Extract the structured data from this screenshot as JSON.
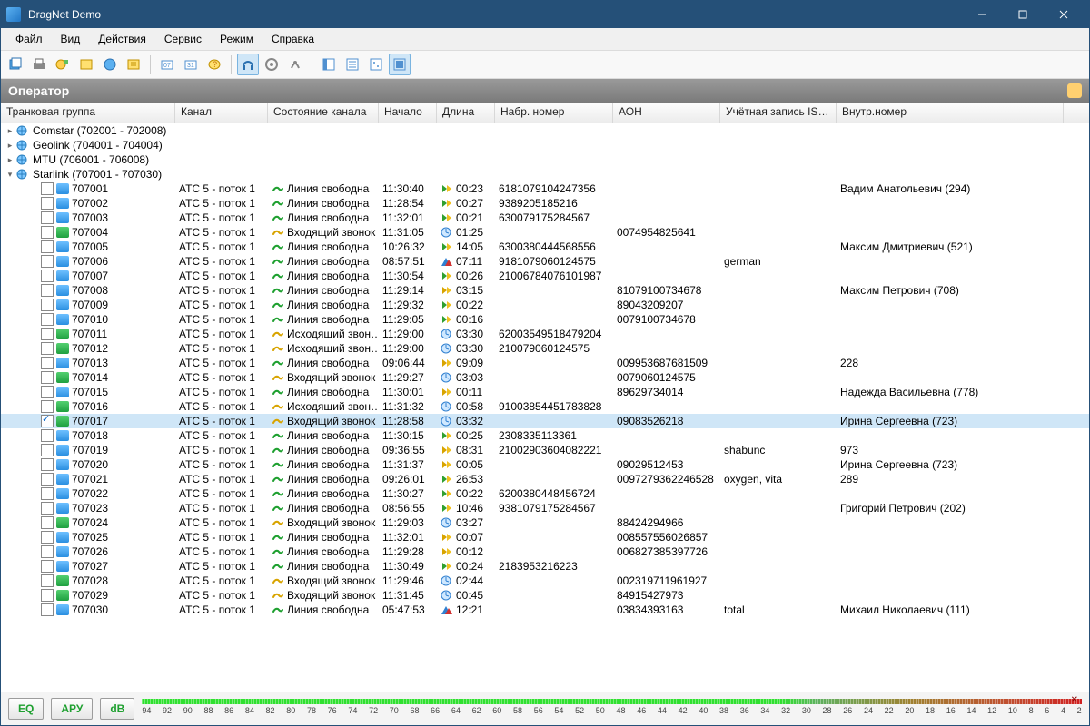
{
  "window": {
    "title": "DragNet Demo"
  },
  "menu": [
    "Файл",
    "Вид",
    "Действия",
    "Сервис",
    "Режим",
    "Справка"
  ],
  "section": {
    "title": "Оператор"
  },
  "columns": {
    "trunk": "Транковая группа",
    "channel": "Канал",
    "state": "Состояние канала",
    "start": "Начало",
    "length": "Длина",
    "dialed": "Набр. номер",
    "aon": "АОН",
    "isdn": "Учётная запись ISDN",
    "ext": "Внутр.номер"
  },
  "trunk_groups": [
    {
      "label": "Comstar (702001 - 702008)",
      "expanded": false
    },
    {
      "label": "Geolink (704001 - 704004)",
      "expanded": false
    },
    {
      "label": "MTU (706001 - 706008)",
      "expanded": false
    },
    {
      "label": "Starlink (707001 - 707030)",
      "expanded": true
    }
  ],
  "rows": [
    {
      "id": "707001",
      "chan": "АТС 5 - поток 1",
      "state": "Линия свободна",
      "si": "free",
      "start": "11:30:40",
      "len": "00:23",
      "li": "play",
      "dialed": "61810791042473­56",
      "aon": "",
      "isdn": "",
      "ext": "Вадим Анатольевич (294)",
      "sel": false,
      "chk": false,
      "ni": "a"
    },
    {
      "id": "707002",
      "chan": "АТС 5 - поток 1",
      "state": "Линия свободна",
      "si": "free",
      "start": "11:28:54",
      "len": "00:27",
      "li": "play",
      "dialed": "9389205185216",
      "aon": "",
      "isdn": "",
      "ext": "",
      "sel": false,
      "chk": false,
      "ni": "a"
    },
    {
      "id": "707003",
      "chan": "АТС 5 - поток 1",
      "state": "Линия свободна",
      "si": "free",
      "start": "11:32:01",
      "len": "00:21",
      "li": "play",
      "dialed": "630079175284567",
      "aon": "",
      "isdn": "",
      "ext": "",
      "sel": false,
      "chk": false,
      "ni": "a"
    },
    {
      "id": "707004",
      "chan": "АТС 5 - поток 1",
      "state": "Входящий звонок",
      "si": "in",
      "start": "11:31:05",
      "len": "01:25",
      "li": "clock",
      "dialed": "",
      "aon": "0074954825641",
      "isdn": "",
      "ext": "",
      "sel": false,
      "chk": false,
      "ni": "b"
    },
    {
      "id": "707005",
      "chan": "АТС 5 - поток 1",
      "state": "Линия свободна",
      "si": "free",
      "start": "10:26:32",
      "len": "14:05",
      "li": "play",
      "dialed": "6300380444568556",
      "aon": "",
      "isdn": "",
      "ext": "Максим Дмитриевич (521)",
      "sel": false,
      "chk": false,
      "ni": "a"
    },
    {
      "id": "707006",
      "chan": "АТС 5 - поток 1",
      "state": "Линия свободна",
      "si": "free",
      "start": "08:57:51",
      "len": "07:11",
      "li": "diag",
      "dialed": "91810790601245­75",
      "aon": "",
      "isdn": "german",
      "ext": "",
      "sel": false,
      "chk": false,
      "ni": "a"
    },
    {
      "id": "707007",
      "chan": "АТС 5 - поток 1",
      "state": "Линия свободна",
      "si": "free",
      "start": "11:30:54",
      "len": "00:26",
      "li": "play",
      "dialed": "21006784076101987",
      "aon": "",
      "isdn": "",
      "ext": "",
      "sel": false,
      "chk": false,
      "ni": "a"
    },
    {
      "id": "707008",
      "chan": "АТС 5 - поток 1",
      "state": "Линия свободна",
      "si": "free",
      "start": "11:29:14",
      "len": "03:15",
      "li": "play2",
      "dialed": "",
      "aon": "81079100734678",
      "isdn": "",
      "ext": "Максим Петрович (708)",
      "sel": false,
      "chk": false,
      "ni": "a"
    },
    {
      "id": "707009",
      "chan": "АТС 5 - поток 1",
      "state": "Линия свободна",
      "si": "free",
      "start": "11:29:32",
      "len": "00:22",
      "li": "play",
      "dialed": "",
      "aon": "89043209207",
      "isdn": "",
      "ext": "",
      "sel": false,
      "chk": false,
      "ni": "a"
    },
    {
      "id": "707010",
      "chan": "АТС 5 - поток 1",
      "state": "Линия свободна",
      "si": "free",
      "start": "11:29:05",
      "len": "00:16",
      "li": "play",
      "dialed": "",
      "aon": "0079100734678",
      "isdn": "",
      "ext": "",
      "sel": false,
      "chk": false,
      "ni": "a"
    },
    {
      "id": "707011",
      "chan": "АТС 5 - поток 1",
      "state": "Исходящий звон…",
      "si": "out",
      "start": "11:29:00",
      "len": "03:30",
      "li": "clock",
      "dialed": "62003549518479204",
      "aon": "",
      "isdn": "",
      "ext": "",
      "sel": false,
      "chk": false,
      "ni": "b"
    },
    {
      "id": "707012",
      "chan": "АТС 5 - поток 1",
      "state": "Исходящий звон…",
      "si": "out",
      "start": "11:29:00",
      "len": "03:30",
      "li": "clock",
      "dialed": "21007906012457­5",
      "aon": "",
      "isdn": "",
      "ext": "",
      "sel": false,
      "chk": false,
      "ni": "b"
    },
    {
      "id": "707013",
      "chan": "АТС 5 - поток 1",
      "state": "Линия свободна",
      "si": "free",
      "start": "09:06:44",
      "len": "09:09",
      "li": "play2",
      "dialed": "",
      "aon": "00995368768150­9",
      "isdn": "",
      "ext": "228",
      "sel": false,
      "chk": false,
      "ni": "a"
    },
    {
      "id": "707014",
      "chan": "АТС 5 - поток 1",
      "state": "Входящий звонок",
      "si": "in",
      "start": "11:29:27",
      "len": "03:03",
      "li": "clock",
      "dialed": "",
      "aon": "0079060124575",
      "isdn": "",
      "ext": "",
      "sel": false,
      "chk": false,
      "ni": "b"
    },
    {
      "id": "707015",
      "chan": "АТС 5 - поток 1",
      "state": "Линия свободна",
      "si": "free",
      "start": "11:30:01",
      "len": "00:11",
      "li": "play2",
      "dialed": "",
      "aon": "89629734014",
      "isdn": "",
      "ext": "Надежда Васильевна (778)",
      "sel": false,
      "chk": false,
      "ni": "a"
    },
    {
      "id": "707016",
      "chan": "АТС 5 - поток 1",
      "state": "Исходящий звон…",
      "si": "out",
      "start": "11:31:32",
      "len": "00:58",
      "li": "clock",
      "dialed": "91003854451783828",
      "aon": "",
      "isdn": "",
      "ext": "",
      "sel": false,
      "chk": false,
      "ni": "b"
    },
    {
      "id": "707017",
      "chan": "АТС 5 - поток 1",
      "state": "Входящий звонок",
      "si": "in",
      "start": "11:28:58",
      "len": "03:32",
      "li": "clock",
      "dialed": "",
      "aon": "09083526218",
      "isdn": "",
      "ext": "Ирина Сергеевна (723)",
      "sel": true,
      "chk": true,
      "ni": "b"
    },
    {
      "id": "707018",
      "chan": "АТС 5 - поток 1",
      "state": "Линия свободна",
      "si": "free",
      "start": "11:30:15",
      "len": "00:25",
      "li": "play",
      "dialed": "2308335113361",
      "aon": "",
      "isdn": "",
      "ext": "",
      "sel": false,
      "chk": false,
      "ni": "a"
    },
    {
      "id": "707019",
      "chan": "АТС 5 - поток 1",
      "state": "Линия свободна",
      "si": "free",
      "start": "09:36:55",
      "len": "08:31",
      "li": "play2",
      "dialed": "21002903604082221",
      "aon": "",
      "isdn": "shabunc",
      "ext": "973",
      "sel": false,
      "chk": false,
      "ni": "a"
    },
    {
      "id": "707020",
      "chan": "АТС 5 - поток 1",
      "state": "Линия свободна",
      "si": "free",
      "start": "11:31:37",
      "len": "00:05",
      "li": "play2",
      "dialed": "",
      "aon": "09029512453",
      "isdn": "",
      "ext": "Ирина Сергеевна (723)",
      "sel": false,
      "chk": false,
      "ni": "a"
    },
    {
      "id": "707021",
      "chan": "АТС 5 - поток 1",
      "state": "Линия свободна",
      "si": "free",
      "start": "09:26:01",
      "len": "26:53",
      "li": "play",
      "dialed": "",
      "aon": "00972793622465­28",
      "isdn": "oxygen, vita",
      "ext": "289",
      "sel": false,
      "chk": false,
      "ni": "a"
    },
    {
      "id": "707022",
      "chan": "АТС 5 - поток 1",
      "state": "Линия свободна",
      "si": "free",
      "start": "11:30:27",
      "len": "00:22",
      "li": "play",
      "dialed": "6200380448456724",
      "aon": "",
      "isdn": "",
      "ext": "",
      "sel": false,
      "chk": false,
      "ni": "a"
    },
    {
      "id": "707023",
      "chan": "АТС 5 - поток 1",
      "state": "Линия свободна",
      "si": "free",
      "start": "08:56:55",
      "len": "10:46",
      "li": "play",
      "dialed": "9381079175284567",
      "aon": "",
      "isdn": "",
      "ext": "Григорий Петрович (202)",
      "sel": false,
      "chk": false,
      "ni": "a"
    },
    {
      "id": "707024",
      "chan": "АТС 5 - поток 1",
      "state": "Входящий звонок",
      "si": "in",
      "start": "11:29:03",
      "len": "03:27",
      "li": "clock",
      "dialed": "",
      "aon": "88424294966",
      "isdn": "",
      "ext": "",
      "sel": false,
      "chk": false,
      "ni": "b"
    },
    {
      "id": "707025",
      "chan": "АТС 5 - поток 1",
      "state": "Линия свободна",
      "si": "free",
      "start": "11:32:01",
      "len": "00:07",
      "li": "play2",
      "dialed": "",
      "aon": "00855755602685­7",
      "isdn": "",
      "ext": "",
      "sel": false,
      "chk": false,
      "ni": "a"
    },
    {
      "id": "707026",
      "chan": "АТС 5 - поток 1",
      "state": "Линия свободна",
      "si": "free",
      "start": "11:29:28",
      "len": "00:12",
      "li": "play2",
      "dialed": "",
      "aon": "00682738539772­6",
      "isdn": "",
      "ext": "",
      "sel": false,
      "chk": false,
      "ni": "a"
    },
    {
      "id": "707027",
      "chan": "АТС 5 - поток 1",
      "state": "Линия свободна",
      "si": "free",
      "start": "11:30:49",
      "len": "00:24",
      "li": "play",
      "dialed": "2183953216223",
      "aon": "",
      "isdn": "",
      "ext": "",
      "sel": false,
      "chk": false,
      "ni": "a"
    },
    {
      "id": "707028",
      "chan": "АТС 5 - поток 1",
      "state": "Входящий звонок",
      "si": "in",
      "start": "11:29:46",
      "len": "02:44",
      "li": "clock",
      "dialed": "",
      "aon": "00231971196192­7",
      "isdn": "",
      "ext": "",
      "sel": false,
      "chk": false,
      "ni": "b"
    },
    {
      "id": "707029",
      "chan": "АТС 5 - поток 1",
      "state": "Входящий звонок",
      "si": "in",
      "start": "11:31:45",
      "len": "00:45",
      "li": "clock",
      "dialed": "",
      "aon": "84915427973",
      "isdn": "",
      "ext": "",
      "sel": false,
      "chk": false,
      "ni": "b"
    },
    {
      "id": "707030",
      "chan": "АТС 5 - поток 1",
      "state": "Линия свободна",
      "si": "free",
      "start": "05:47:53",
      "len": "12:21",
      "li": "diag2",
      "dialed": "",
      "aon": "03834393163",
      "isdn": "total",
      "ext": "Михаил Николаевич (111)",
      "sel": false,
      "chk": false,
      "ni": "a"
    }
  ],
  "footer": {
    "eq": "EQ",
    "aru": "АРУ",
    "db": "dB",
    "ticks": [
      "94",
      "92",
      "90",
      "88",
      "86",
      "84",
      "82",
      "80",
      "78",
      "76",
      "74",
      "72",
      "70",
      "68",
      "66",
      "64",
      "62",
      "60",
      "58",
      "56",
      "54",
      "52",
      "50",
      "48",
      "46",
      "44",
      "42",
      "40",
      "38",
      "36",
      "34",
      "32",
      "30",
      "28",
      "26",
      "24",
      "22",
      "20",
      "18",
      "16",
      "14",
      "12",
      "10",
      "8",
      "6",
      "4",
      "2"
    ]
  }
}
